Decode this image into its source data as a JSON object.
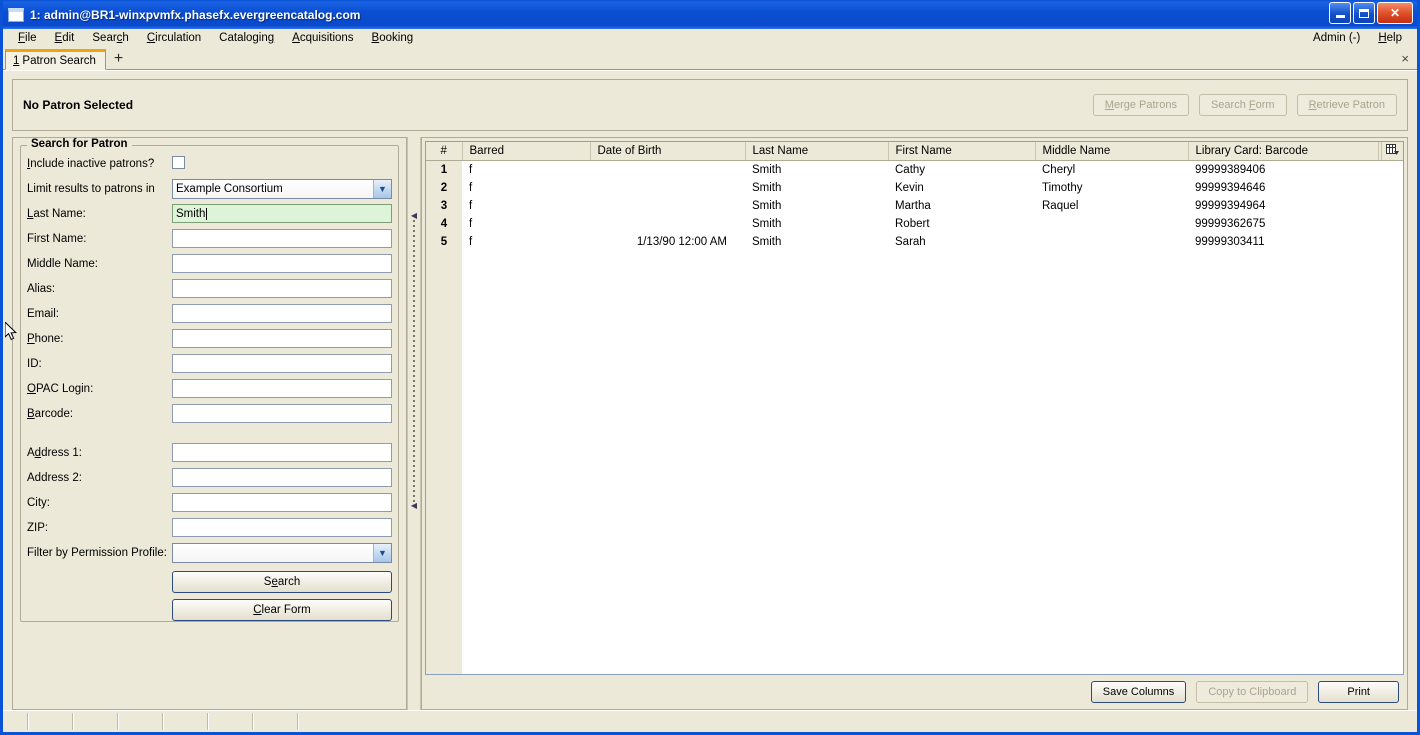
{
  "window": {
    "title": "1: admin@BR1-winxpvmfx.phasefx.evergreencatalog.com",
    "icon": "window-icon",
    "minimize_label": "Minimize",
    "maximize_label": "Maximize",
    "close_label": "✕"
  },
  "menubar": {
    "items": [
      {
        "label": "File",
        "accel": "F"
      },
      {
        "label": "Edit",
        "accel": "E"
      },
      {
        "label": "Search",
        "accel": "c"
      },
      {
        "label": "Circulation",
        "accel": "C"
      },
      {
        "label": "Cataloging",
        "accel": "g"
      },
      {
        "label": "Acquisitions",
        "accel": "A"
      },
      {
        "label": "Booking",
        "accel": "B"
      }
    ],
    "right_items": [
      {
        "label": "Admin (-)"
      },
      {
        "label": "Help"
      }
    ]
  },
  "tabbar": {
    "active_tab_number": "1",
    "active_tab_label": "Patron Search",
    "new_tab_glyph": "+",
    "close_glyph": "×"
  },
  "patron_bar": {
    "status_text": "No Patron Selected",
    "buttons": [
      {
        "label": "Merge Patrons",
        "accel": "M",
        "enabled": false
      },
      {
        "label": "Search Form",
        "accel": "F",
        "enabled": false
      },
      {
        "label": "Retrieve Patron",
        "accel": "R",
        "enabled": false
      }
    ]
  },
  "search_form": {
    "legend": "Search for Patron",
    "fields": [
      {
        "label": "Include inactive patrons?",
        "type": "checkbox",
        "value": "",
        "checked": false
      },
      {
        "label": "Limit results to patrons in",
        "type": "select",
        "value": "Example Consortium"
      },
      {
        "label": "Last Name:",
        "type": "text",
        "value": "Smith",
        "focused": true
      },
      {
        "label": "First Name:",
        "type": "text",
        "value": ""
      },
      {
        "label": "Middle Name:",
        "type": "text",
        "value": ""
      },
      {
        "label": "Alias:",
        "type": "text",
        "value": ""
      },
      {
        "label": "Email:",
        "type": "text",
        "value": ""
      },
      {
        "label": "Phone:",
        "type": "text",
        "value": ""
      },
      {
        "label": "ID:",
        "type": "text",
        "value": ""
      },
      {
        "label": "OPAC Login:",
        "type": "text",
        "value": ""
      },
      {
        "label": "Barcode:",
        "type": "text",
        "value": ""
      },
      {
        "label": "Address 1:",
        "type": "text",
        "value": "",
        "gap_before": true
      },
      {
        "label": "Address 2:",
        "type": "text",
        "value": ""
      },
      {
        "label": "City:",
        "type": "text",
        "value": ""
      },
      {
        "label": "ZIP:",
        "type": "text",
        "value": ""
      },
      {
        "label": "Filter by Permission Profile:",
        "type": "select",
        "value": ""
      }
    ],
    "search_button": "Search",
    "clear_button": "Clear Form"
  },
  "results": {
    "columns": [
      "#",
      "Barred",
      "Date of Birth",
      "Last Name",
      "First Name",
      "Middle Name",
      "Library Card: Barcode"
    ],
    "column_picker_icon": "column-picker-icon",
    "rows": [
      {
        "num": "1",
        "barred": "f",
        "dob": "",
        "last": "Smith",
        "first": "Cathy",
        "middle": "Cheryl",
        "barcode": "99999389406"
      },
      {
        "num": "2",
        "barred": "f",
        "dob": "",
        "last": "Smith",
        "first": "Kevin",
        "middle": "Timothy",
        "barcode": "99999394646"
      },
      {
        "num": "3",
        "barred": "f",
        "dob": "",
        "last": "Smith",
        "first": "Martha",
        "middle": "Raquel",
        "barcode": "99999394964"
      },
      {
        "num": "4",
        "barred": "f",
        "dob": "",
        "last": "Smith",
        "first": "Robert",
        "middle": "",
        "barcode": "99999362675"
      },
      {
        "num": "5",
        "barred": "f",
        "dob": "1/13/90 12:00 AM",
        "last": "Smith",
        "first": "Sarah",
        "middle": "",
        "barcode": "99999303411"
      }
    ],
    "buttons": [
      {
        "label": "Save Columns",
        "enabled": true
      },
      {
        "label": "Copy to Clipboard",
        "enabled": false
      },
      {
        "label": "Print",
        "enabled": true
      }
    ]
  },
  "statusbar": {
    "cells": [
      "",
      "",
      "",
      "",
      "",
      "",
      ""
    ]
  },
  "colors": {
    "titlebar_blue": "#0a4fd0",
    "chrome_beige": "#ece9d8",
    "focus_green": "#ddf4d8",
    "tab_accent": "#f0a30a",
    "grid_border": "#8ba0bb"
  }
}
